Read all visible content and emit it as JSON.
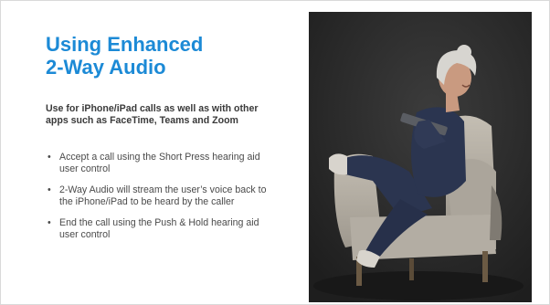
{
  "slide": {
    "title": "Using Enhanced\n2-Way Audio",
    "subtitle": "Use for iPhone/iPad calls as well as with other apps such as FaceTime, Teams and Zoom",
    "bullets": [
      "Accept a call using the Short Press hearing aid user control",
      "2-Way Audio will stream the user’s voice back to the iPhone/iPad to be heard by the caller",
      "End the call using the Push & Hold hearing aid user control"
    ],
    "bullet_glyph": "•"
  },
  "photo": {
    "subject": "smiling-woman-in-armchair-with-tablet",
    "colors": {
      "background": "#2b2b2b",
      "chair": "#b8b2a8",
      "outfit": "#2b3550",
      "hair": "#d7d5d0",
      "skin": "#c99a80"
    }
  },
  "theme": {
    "title_color": "#1c8ad6",
    "text_color": "#4a4a4a"
  }
}
